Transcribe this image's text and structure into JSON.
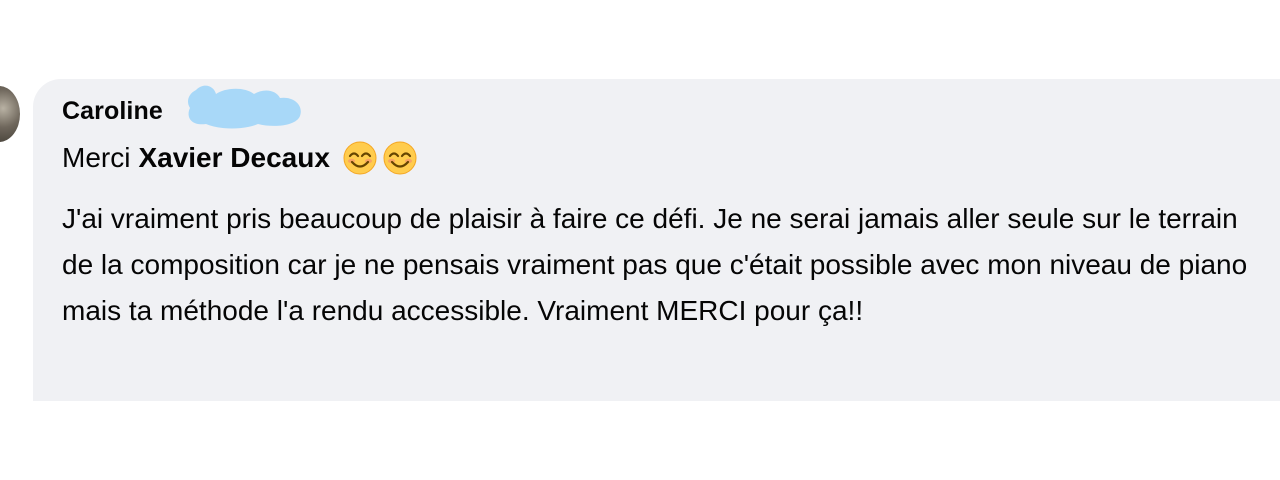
{
  "comment": {
    "author": "Caroline",
    "mention_prefix": "Merci",
    "mention_name": "Xavier Decaux",
    "emojis": [
      "smiling-face-with-smiling-eyes-icon",
      "smiling-face-with-smiling-eyes-icon"
    ],
    "body": "J'ai vraiment pris beaucoup de plaisir à faire ce défi. Je ne serai jamais aller seule sur le terrain de la composition car je ne pensais vraiment pas que c'était possible avec mon niveau de piano mais ta méthode l'a rendu accessible. Vraiment MERCI pour ça!!"
  },
  "colors": {
    "bubble_background": "#f0f1f4",
    "text": "#050505",
    "redaction": "#a8d8f8"
  }
}
